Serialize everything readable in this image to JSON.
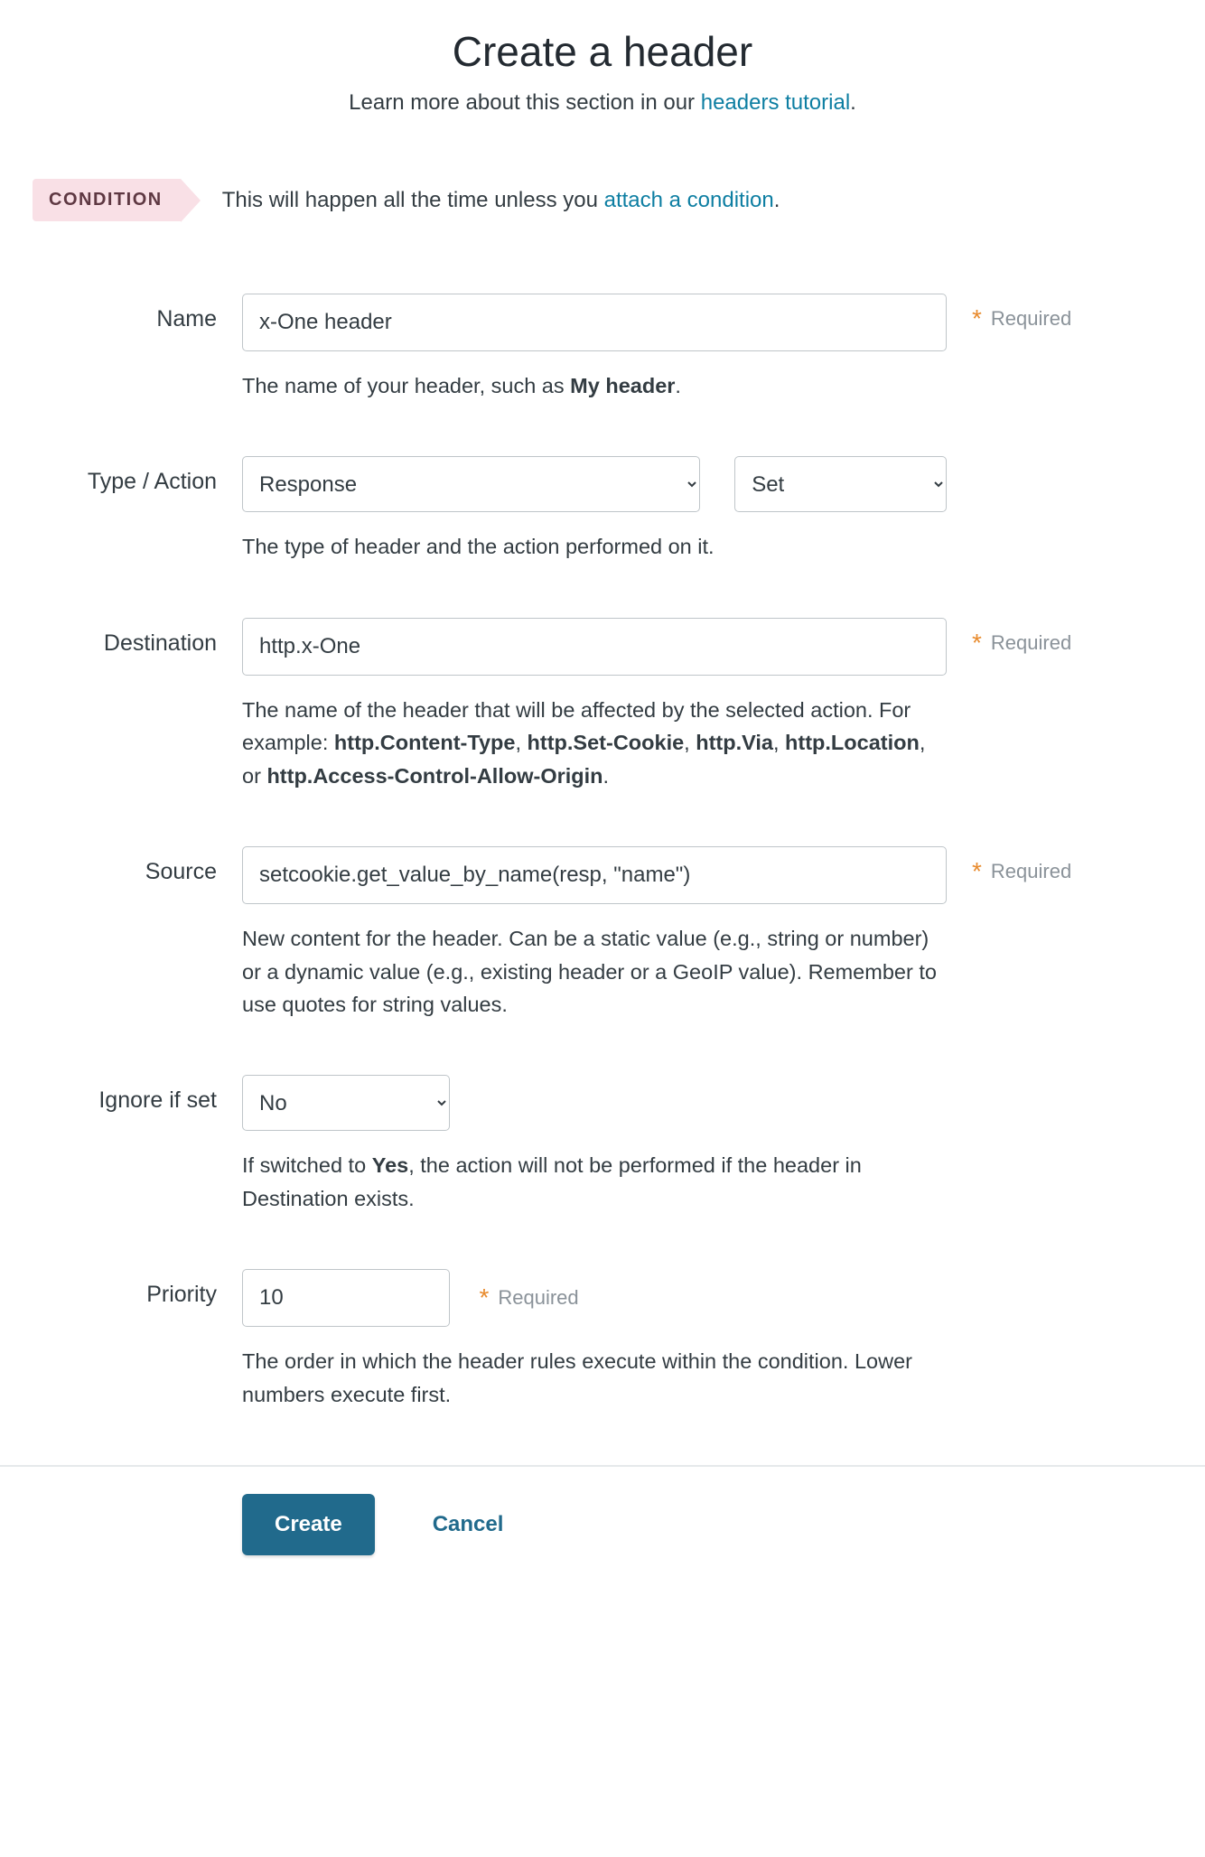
{
  "page": {
    "title": "Create a header",
    "subtitle_prefix": "Learn more about this section in our ",
    "subtitle_link": "headers tutorial",
    "subtitle_suffix": "."
  },
  "condition": {
    "tag": "CONDITION",
    "text_prefix": "This will happen all the time unless you ",
    "link": "attach a condition",
    "suffix": "."
  },
  "required_label": "Required",
  "fields": {
    "name": {
      "label": "Name",
      "value": "x-One header",
      "help_prefix": "The name of your header, such as ",
      "help_bold": "My header",
      "help_suffix": "."
    },
    "type_action": {
      "label": "Type / Action",
      "type_value": "Response",
      "action_value": "Set",
      "help": "The type of header and the action performed on it."
    },
    "destination": {
      "label": "Destination",
      "value": "http.x-One",
      "help_p1": "The name of the header that will be affected by the selected action. For example: ",
      "help_b1": "http.Content-Type",
      "sep1": ", ",
      "help_b2": "http.Set-Cookie",
      "sep2": ", ",
      "help_b3": "http.Via",
      "sep3": ", ",
      "help_b4": "http.Location",
      "sep4": ", or ",
      "help_b5": "http.Access-Control-Allow-Origin",
      "help_suffix": "."
    },
    "source": {
      "label": "Source",
      "value": "setcookie.get_value_by_name(resp, \"name\")",
      "help": "New content for the header. Can be a static value (e.g., string or number) or a dynamic value (e.g., existing header or a GeoIP value). Remember to use quotes for string values."
    },
    "ignore": {
      "label": "Ignore if set",
      "value": "No",
      "help_prefix": "If switched to ",
      "help_bold": "Yes",
      "help_suffix": ", the action will not be performed if the header in Destination exists."
    },
    "priority": {
      "label": "Priority",
      "value": "10",
      "help": "The order in which the header rules execute within the condition. Lower numbers execute first."
    }
  },
  "footer": {
    "create": "Create",
    "cancel": "Cancel"
  }
}
